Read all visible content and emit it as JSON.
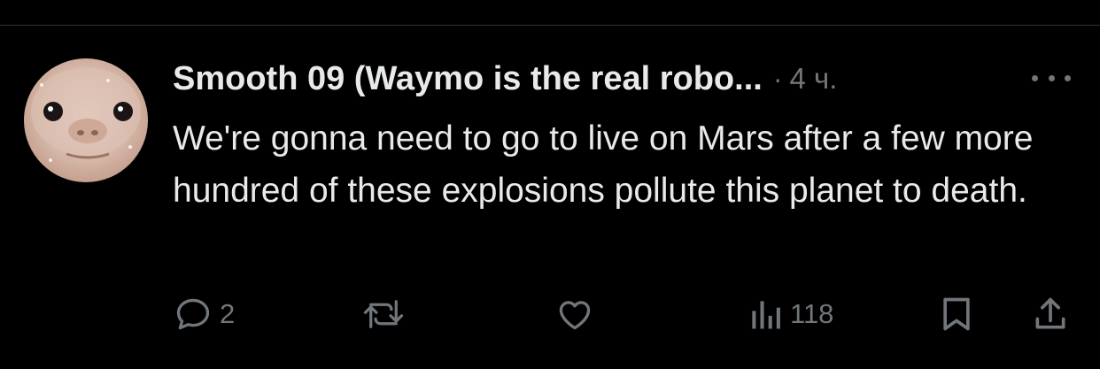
{
  "tweet": {
    "author": {
      "display_name": "Smooth 09 (Waymo is the real robo...",
      "avatar_icon": "face-avatar"
    },
    "separator": "·",
    "time": "4 ч.",
    "more_icon": "more-icon",
    "text": "We're gonna need to go to live on Mars after a few more hundred of these explosions pollute this planet to death."
  },
  "actions": {
    "reply": {
      "icon": "reply-icon",
      "count": "2"
    },
    "retweet": {
      "icon": "retweet-icon",
      "count": ""
    },
    "like": {
      "icon": "heart-icon",
      "count": ""
    },
    "views": {
      "icon": "views-icon",
      "count": "118"
    },
    "bookmark": {
      "icon": "bookmark-icon"
    },
    "share": {
      "icon": "share-icon"
    }
  },
  "colors": {
    "background": "#000000",
    "text_primary": "#e7e9ea",
    "text_secondary": "#71767b",
    "divider": "#2f3336"
  }
}
